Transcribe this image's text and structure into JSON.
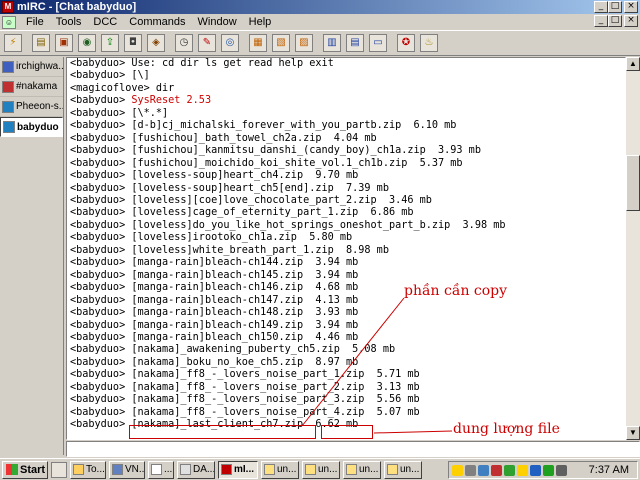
{
  "window": {
    "title": "mIRC - [Chat babyduo]",
    "app_icon": "M"
  },
  "titlebar_buttons": [
    "_",
    "□",
    "×"
  ],
  "menu": {
    "items": [
      "File",
      "Tools",
      "DCC",
      "Commands",
      "Window",
      "Help"
    ]
  },
  "toolbar": {
    "icons": [
      "connect-icon",
      "options-icon",
      "channels-icon",
      "address-book-icon",
      "dcc-send-icon",
      "dcc-chat-icon",
      "notify-icon",
      "timer-icon",
      "colors-icon",
      "url-icon",
      "scripts-editor-icon",
      "popups-icon",
      "remote-icon",
      "tile-icon",
      "cascade-icon",
      "arrange-icon",
      "help-icon",
      "about-icon"
    ]
  },
  "switchbar": {
    "items": [
      {
        "label": "irchighwa...",
        "color": "#4060c0",
        "active": false
      },
      {
        "label": "#nakama",
        "color": "#c03030",
        "active": false
      },
      {
        "label": "Pheeon-s...",
        "color": "#2080c0",
        "active": false
      },
      {
        "label": "babyduo",
        "color": "#2080c0",
        "active": true
      }
    ]
  },
  "chat": {
    "lines": [
      {
        "nick": "<babyduo>",
        "msg": "Use: cd dir ls get read help exit",
        "red": false
      },
      {
        "nick": "<babyduo>",
        "msg": "[\\]",
        "red": false
      },
      {
        "nick": "<magicoflove>",
        "msg": "dir",
        "red": false
      },
      {
        "nick": "<babyduo>",
        "msg": "SysReset 2.53",
        "red": true
      },
      {
        "nick": "<babyduo>",
        "msg": "[\\*.*]",
        "red": false
      },
      {
        "nick": "<babyduo>",
        "msg": "[d-b]cj_michalski_forever_with_you_partb.zip  6.10 mb",
        "red": false
      },
      {
        "nick": "<babyduo>",
        "msg": "[fushichou]_bath_towel_ch2a.zip  4.04 mb",
        "red": false
      },
      {
        "nick": "<babyduo>",
        "msg": "[fushichou]_kanmitsu_danshi_(candy_boy)_ch1a.zip  3.93 mb",
        "red": false
      },
      {
        "nick": "<babyduo>",
        "msg": "[fushichou]_moichido_koi_shite_vol.1_ch1b.zip  5.37 mb",
        "red": false
      },
      {
        "nick": "<babyduo>",
        "msg": "[loveless-soup]heart_ch4.zip  9.70 mb",
        "red": false
      },
      {
        "nick": "<babyduo>",
        "msg": "[loveless-soup]heart_ch5[end].zip  7.39 mb",
        "red": false
      },
      {
        "nick": "<babyduo>",
        "msg": "[loveless][coe]love_chocolate_part_2.zip  3.46 mb",
        "red": false
      },
      {
        "nick": "<babyduo>",
        "msg": "[loveless]cage_of_eternity_part_1.zip  6.86 mb",
        "red": false
      },
      {
        "nick": "<babyduo>",
        "msg": "[loveless]do_you_like_hot_springs_oneshot_part_b.zip  3.98 mb",
        "red": false
      },
      {
        "nick": "<babyduo>",
        "msg": "[loveless]irootoko_ch1a.zip  5.80 mb",
        "red": false
      },
      {
        "nick": "<babyduo>",
        "msg": "[loveless]white_breath_part_1.zip  8.98 mb",
        "red": false
      },
      {
        "nick": "<babyduo>",
        "msg": "[manga-rain]bleach-ch144.zip  3.94 mb",
        "red": false
      },
      {
        "nick": "<babyduo>",
        "msg": "[manga-rain]bleach-ch145.zip  3.94 mb",
        "red": false
      },
      {
        "nick": "<babyduo>",
        "msg": "[manga-rain]bleach-ch146.zip  4.68 mb",
        "red": false
      },
      {
        "nick": "<babyduo>",
        "msg": "[manga-rain]bleach-ch147.zip  4.13 mb",
        "red": false
      },
      {
        "nick": "<babyduo>",
        "msg": "[manga-rain]bleach-ch148.zip  3.93 mb",
        "red": false
      },
      {
        "nick": "<babyduo>",
        "msg": "[manga-rain]bleach-ch149.zip  3.94 mb",
        "red": false
      },
      {
        "nick": "<babyduo>",
        "msg": "[manga-rain]bleach_ch150.zip  4.46 mb",
        "red": false
      },
      {
        "nick": "<babyduo>",
        "msg": "[nakama]_awakening_puberty_ch5.zip  5.08 mb",
        "red": false
      },
      {
        "nick": "<babyduo>",
        "msg": "[nakama]_boku_no_koe_ch5.zip  8.97 mb",
        "red": false
      },
      {
        "nick": "<babyduo>",
        "msg": "[nakama]_ff8_-_lovers_noise_part_1.zip  5.71 mb",
        "red": false
      },
      {
        "nick": "<babyduo>",
        "msg": "[nakama]_ff8_-_lovers_noise_part_2.zip  3.13 mb",
        "red": false
      },
      {
        "nick": "<babyduo>",
        "msg": "[nakama]_ff8_-_lovers_noise_part_3.zip  5.56 mb",
        "red": false
      },
      {
        "nick": "<babyduo>",
        "msg": "[nakama]_ff8_-_lovers_noise_part_4.zip  5.07 mb",
        "red": false
      }
    ],
    "last_line": {
      "nick": "<babyduo>",
      "file": "[nakama]_last_client_ch7.zip",
      "size": "6.62 mb"
    }
  },
  "annotations": {
    "copy_label": "phần cần copy",
    "size_label": "dung lượng file",
    "color": "#cc0000"
  },
  "taskbar": {
    "start_label": "Start",
    "tasks": [
      {
        "label": "To...",
        "active": false
      },
      {
        "label": "VN...",
        "active": false
      },
      {
        "label": "...",
        "active": false
      },
      {
        "label": "DA...",
        "active": false
      },
      {
        "label": "mI...",
        "active": true
      },
      {
        "label": "un...",
        "active": false
      },
      {
        "label": "un...",
        "active": false
      },
      {
        "label": "un...",
        "active": false
      },
      {
        "label": "un...",
        "active": false
      }
    ],
    "clock": "7:37 AM"
  }
}
